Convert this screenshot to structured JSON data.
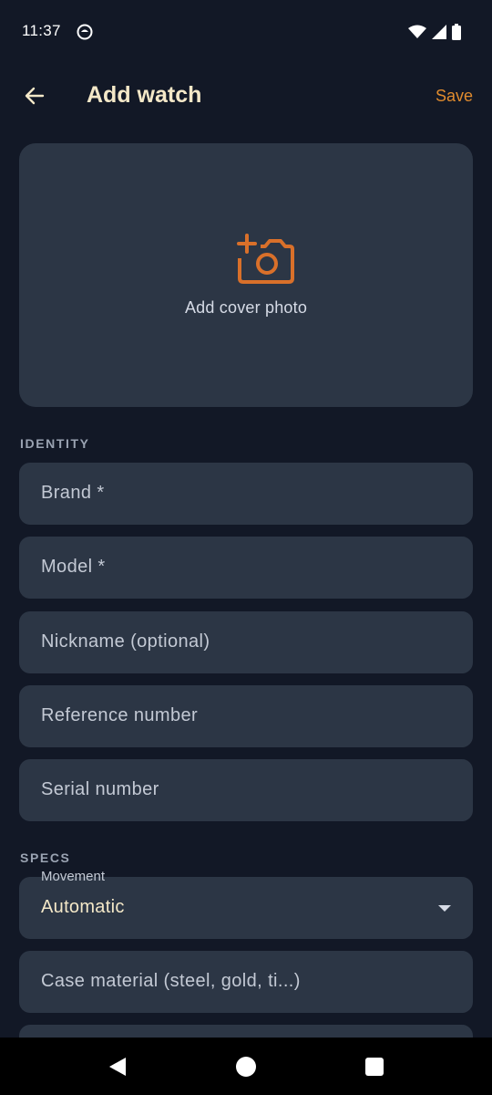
{
  "status_bar": {
    "time": "11:37"
  },
  "app_bar": {
    "title": "Add watch",
    "save_label": "Save"
  },
  "cover_photo": {
    "label": "Add cover photo"
  },
  "sections": {
    "identity": "IDENTITY",
    "specs": "SPECS"
  },
  "identity_fields": {
    "brand": "Brand *",
    "model": "Model *",
    "nickname": "Nickname (optional)",
    "reference": "Reference number",
    "serial": "Serial number"
  },
  "specs_fields": {
    "movement_label": "Movement",
    "movement_value": "Automatic",
    "case_material": "Case material (steel, gold, ti...)"
  },
  "colors": {
    "background": "#121826",
    "surface": "#2c3645",
    "accent": "#e08b2e",
    "title": "#f4e8c8"
  }
}
